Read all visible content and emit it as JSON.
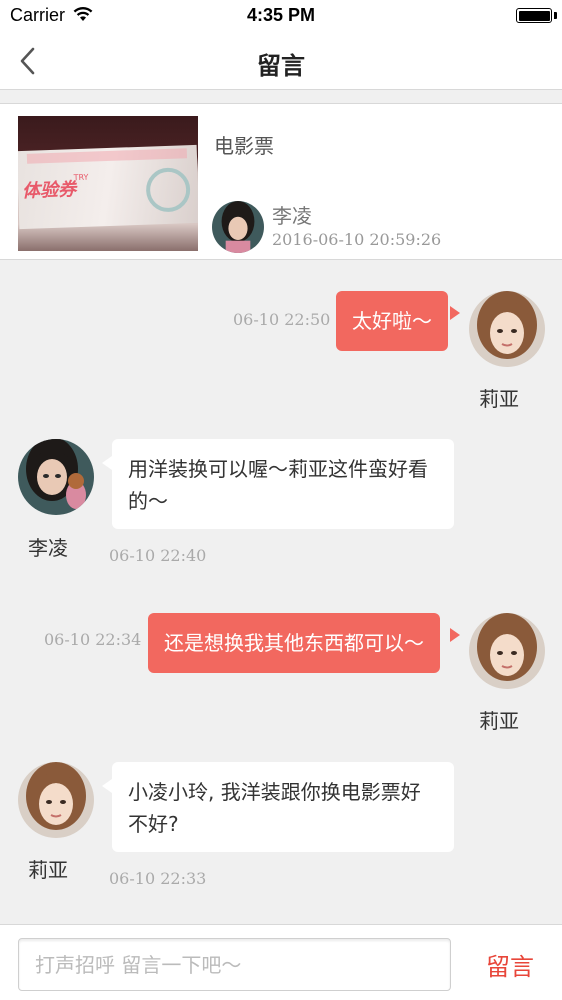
{
  "status_bar": {
    "carrier": "Carrier",
    "time": "4:35 PM"
  },
  "nav": {
    "title": "留言",
    "back_icon": "chevron-left-icon"
  },
  "product": {
    "title": "电影票",
    "thumbnail_text": "体验券",
    "thumbnail_subtext": "TRY",
    "seller_name": "李凌",
    "post_time": "2016-06-10 20:59:26"
  },
  "messages": [
    {
      "side": "right",
      "text": "太好啦～",
      "time": "06-10 22:50",
      "sender": "莉亚"
    },
    {
      "side": "left",
      "text": "用洋装换可以喔～莉亚这件蛮好看的～",
      "time": "06-10 22:40",
      "sender": "李凌"
    },
    {
      "side": "right",
      "text": "还是想换我其他东西都可以～",
      "time": "06-10 22:34",
      "sender": "莉亚"
    },
    {
      "side": "left",
      "text": "小凌小玲, 我洋装跟你换电影票好不好?",
      "time": "06-10 22:33",
      "sender": "莉亚"
    }
  ],
  "input": {
    "placeholder": "打声招呼 留言一下吧～",
    "value": ""
  },
  "send_button": {
    "label": "留言"
  },
  "colors": {
    "accent": "#f2685f",
    "send": "#e8463a",
    "background": "#f0f0f0"
  }
}
